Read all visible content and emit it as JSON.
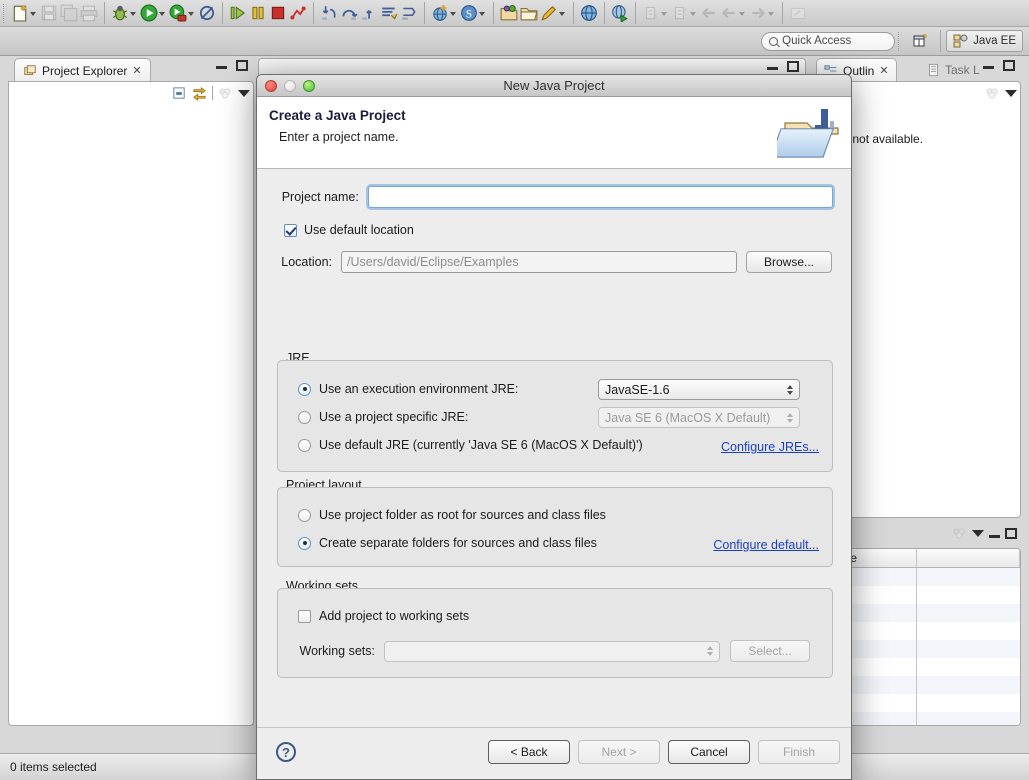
{
  "app": {
    "perspective": "Java EE",
    "status": "0 items selected"
  },
  "quick_access": {
    "placeholder": "Quick Access",
    "icon": "search-icon"
  },
  "toolbar": {
    "groups": [
      {
        "items": [
          {
            "name": "new-wizard",
            "icon": "new-file-icon",
            "arrow": true,
            "enabled": true
          },
          {
            "name": "save",
            "icon": "save-icon",
            "arrow": false,
            "enabled": false
          },
          {
            "name": "save-all",
            "icon": "save-all-icon",
            "arrow": false,
            "enabled": false
          },
          {
            "name": "print",
            "icon": "print-icon",
            "arrow": false,
            "enabled": false
          }
        ]
      },
      {
        "items": [
          {
            "name": "debug",
            "icon": "debug-bug-icon",
            "arrow": true,
            "enabled": true
          },
          {
            "name": "run",
            "icon": "run-play-icon",
            "arrow": true,
            "enabled": true
          },
          {
            "name": "profile",
            "icon": "profile-icon",
            "arrow": true,
            "enabled": true
          },
          {
            "name": "skip-breakpoints",
            "icon": "skip-breakpoints-icon",
            "arrow": false,
            "enabled": true
          }
        ]
      },
      {
        "items": [
          {
            "name": "resume",
            "icon": "resume-icon",
            "arrow": false,
            "enabled": true
          },
          {
            "name": "suspend",
            "icon": "suspend-icon",
            "arrow": false,
            "enabled": true
          },
          {
            "name": "terminate",
            "icon": "terminate-icon",
            "arrow": false,
            "enabled": true
          },
          {
            "name": "disconnect",
            "icon": "disconnect-icon",
            "arrow": false,
            "enabled": true
          }
        ]
      },
      {
        "items": [
          {
            "name": "step-into",
            "icon": "step-into-icon",
            "arrow": false,
            "enabled": true
          },
          {
            "name": "step-over",
            "icon": "step-over-icon",
            "arrow": false,
            "enabled": true
          },
          {
            "name": "step-return",
            "icon": "step-return-icon",
            "arrow": false,
            "enabled": true
          },
          {
            "name": "step-filters",
            "icon": "step-filters-icon",
            "arrow": false,
            "enabled": true
          },
          {
            "name": "drop-to-frame",
            "icon": "drop-to-frame-icon",
            "arrow": false,
            "enabled": true
          }
        ]
      },
      {
        "items": [
          {
            "name": "new-web-project",
            "icon": "web-globe-new-icon",
            "arrow": true,
            "enabled": true
          },
          {
            "name": "new-server",
            "icon": "server-s-icon",
            "arrow": true,
            "enabled": true
          }
        ]
      },
      {
        "items": [
          {
            "name": "open-type",
            "icon": "open-folder-green-icon",
            "arrow": false,
            "enabled": true
          },
          {
            "name": "open-task",
            "icon": "open-folder-icon",
            "arrow": false,
            "enabled": true
          },
          {
            "name": "new-annotation",
            "icon": "pencil-icon",
            "arrow": true,
            "enabled": true
          }
        ]
      },
      {
        "items": [
          {
            "name": "open-browser",
            "icon": "globe-icon",
            "arrow": false,
            "enabled": true
          }
        ]
      },
      {
        "items": [
          {
            "name": "run-on-server",
            "icon": "run-on-server-icon",
            "arrow": false,
            "enabled": true
          }
        ]
      },
      {
        "items": [
          {
            "name": "next-annotation",
            "icon": "next-annotation-icon",
            "arrow": true,
            "enabled": false
          },
          {
            "name": "previous-annotation",
            "icon": "prev-annotation-icon",
            "arrow": true,
            "enabled": false
          },
          {
            "name": "last-edit-location",
            "icon": "back-arrow-icon",
            "arrow": false,
            "enabled": false
          },
          {
            "name": "back",
            "icon": "back-arrow-icon",
            "arrow": true,
            "enabled": false
          },
          {
            "name": "forward",
            "icon": "forward-arrow-icon",
            "arrow": true,
            "enabled": false
          }
        ]
      },
      {
        "items": [
          {
            "name": "restore-view",
            "icon": "restore-view-icon",
            "arrow": false,
            "enabled": false
          }
        ]
      }
    ],
    "open-perspective": "open-perspective-icon"
  },
  "project_explorer": {
    "tab_label": "Project Explorer",
    "close_glyph": "✕",
    "toolbar": [
      {
        "name": "collapse-all-icon"
      },
      {
        "name": "link-with-editor-icon"
      },
      {
        "name": "view-menu-extra-icon"
      }
    ]
  },
  "right_stack": {
    "tabs": [
      {
        "label": "Outlin",
        "active": true,
        "close_glyph": "✕"
      },
      {
        "label": "Task L",
        "active": false,
        "icon": "task-list-icon"
      }
    ],
    "message": "ine is not available."
  },
  "bottom_right_view": {
    "columns": [
      "",
      "Type",
      ""
    ],
    "rows": 9
  },
  "dialog": {
    "title": "New Java Project",
    "traffic_lights": [
      "close-light",
      "minimize-light",
      "zoom-light"
    ],
    "banner": {
      "title": "Create a Java Project",
      "subtitle": "Enter a project name.",
      "icon": "java-project-folder-icon"
    },
    "project_name": {
      "label": "Project name:",
      "value": "",
      "placeholder": "",
      "focused": true
    },
    "use_default_location": {
      "label": "Use default location",
      "checked": true
    },
    "location": {
      "label": "Location:",
      "value": "/Users/david/Eclipse/Examples",
      "enabled": false,
      "browse_label": "Browse..."
    },
    "jre": {
      "group_title": "JRE",
      "options": [
        {
          "label": "Use an execution environment JRE:",
          "selected": true
        },
        {
          "label": "Use a project specific JRE:",
          "selected": false
        },
        {
          "label": "Use default JRE (currently 'Java SE 6 (MacOS X Default)')",
          "selected": false
        }
      ],
      "execution_env_value": "JavaSE-1.6",
      "specific_jre_value": "Java SE 6 (MacOS X Default)",
      "configure_link": "Configure JREs..."
    },
    "project_layout": {
      "group_title": "Project layout",
      "options": [
        {
          "label": "Use project folder as root for sources and class files",
          "selected": false
        },
        {
          "label": "Create separate folders for sources and class files",
          "selected": true
        }
      ],
      "configure_link": "Configure default..."
    },
    "working_sets": {
      "group_title": "Working sets",
      "add_checkbox": {
        "label": "Add project to working sets",
        "checked": false
      },
      "label": "Working sets:",
      "value": "",
      "select_label": "Select...",
      "enabled": false
    },
    "footer": {
      "help_glyph": "?",
      "buttons": [
        {
          "label": "< Back",
          "enabled": true,
          "name": "back-button"
        },
        {
          "label": "Next >",
          "enabled": false,
          "name": "next-button"
        },
        {
          "label": "Cancel",
          "enabled": true,
          "name": "cancel-button"
        },
        {
          "label": "Finish",
          "enabled": false,
          "name": "finish-button"
        }
      ]
    }
  },
  "colors": {
    "accent_link": "#1a3fc4",
    "dialog_bg": "#ededed",
    "focus_ring": "#6fa8dc"
  }
}
